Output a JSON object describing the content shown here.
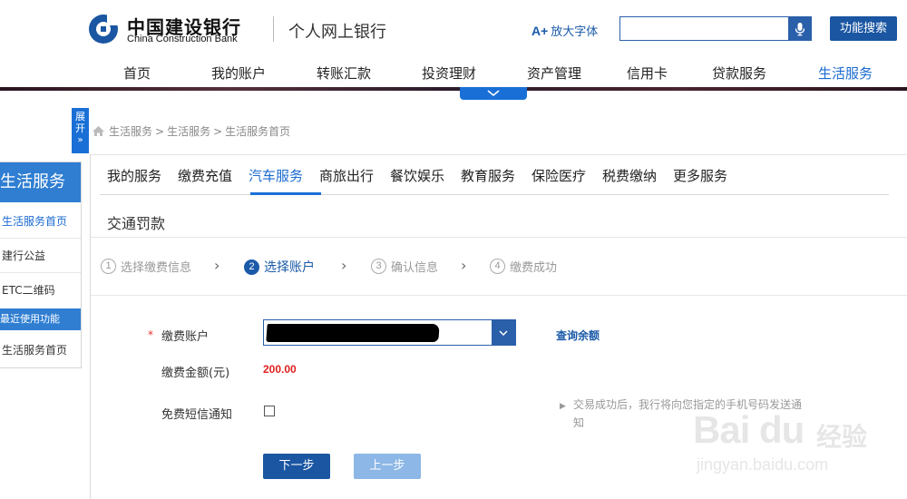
{
  "header": {
    "brand_cn": "中国建设银行",
    "brand_en": "China Construction Bank",
    "sub_title": "个人网上银行",
    "font_enlarge": "放大字体",
    "search": {
      "value": "",
      "placeholder": ""
    },
    "function_search": "功能搜索",
    "brand_color": "#1a56a2"
  },
  "main_nav": {
    "items": [
      {
        "label": "首页"
      },
      {
        "label": "我的账户"
      },
      {
        "label": "转账汇款"
      },
      {
        "label": "投资理财"
      },
      {
        "label": "资产管理"
      },
      {
        "label": "信用卡"
      },
      {
        "label": "贷款服务"
      },
      {
        "label": "生活服务"
      }
    ],
    "active": "生活服务"
  },
  "sidebar": {
    "expand_label": "展开",
    "title": "生活服务",
    "items": [
      {
        "label": "生活服务首页"
      },
      {
        "label": "建行公益"
      },
      {
        "label": "ETC二维码"
      }
    ],
    "recent_title": "最近使用功能",
    "recent_items": [
      {
        "label": "生活服务首页"
      }
    ]
  },
  "breadcrumb": [
    "生活服务",
    "生活服务",
    "生活服务首页"
  ],
  "service_tabs": {
    "items": [
      {
        "label": "我的服务"
      },
      {
        "label": "缴费充值"
      },
      {
        "label": "汽车服务"
      },
      {
        "label": "商旅出行"
      },
      {
        "label": "餐饮娱乐"
      },
      {
        "label": "教育服务"
      },
      {
        "label": "保险医疗"
      },
      {
        "label": "税费缴纳"
      },
      {
        "label": "更多服务"
      }
    ],
    "active": "汽车服务"
  },
  "section_title": "交通罚款",
  "steps": [
    {
      "num": "1",
      "label": "选择缴费信息",
      "active": false
    },
    {
      "num": "2",
      "label": "选择账户",
      "active": true
    },
    {
      "num": "3",
      "label": "确认信息",
      "active": false
    },
    {
      "num": "4",
      "label": "缴费成功",
      "active": false
    }
  ],
  "form": {
    "required_mark": "*",
    "account_label": "缴费账户",
    "account_value_masked": true,
    "balance_link": "查询余额",
    "amount_label": "缴费金额(元)",
    "amount_value": "200.00",
    "sms_label": "免费短信通知",
    "sms_checked": false,
    "sms_note": "交易成功后，我行将向您指定的手机号码发送通知",
    "next_button": "下一步",
    "prev_button": "上一步"
  },
  "watermark": {
    "logo": "Bai du",
    "cn": "经验",
    "url": "jingyan.baidu.com"
  }
}
